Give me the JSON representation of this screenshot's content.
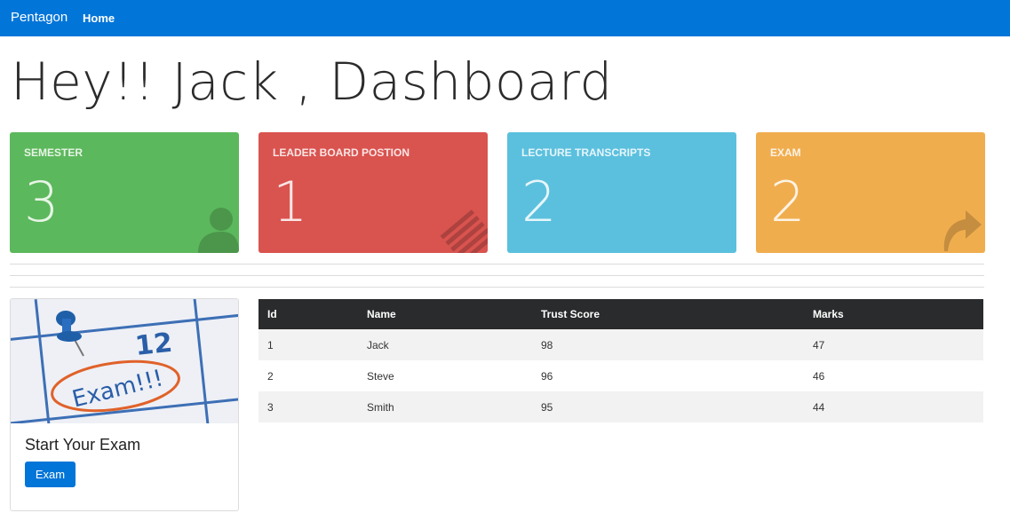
{
  "navbar": {
    "brand": "Pentagon",
    "home_label": "Home"
  },
  "page": {
    "title": "Hey!! Jack , Dashboard"
  },
  "stats": [
    {
      "label": "SEMESTER",
      "value": "3",
      "color": "#5cb85c",
      "icon": "user-icon"
    },
    {
      "label": "LEADER BOARD POSTION",
      "value": "1",
      "color": "#d9534f",
      "icon": "list-icon"
    },
    {
      "label": "LECTURE TRANSCRIPTS",
      "value": "2",
      "color": "#5bc0de",
      "icon": "document-icon"
    },
    {
      "label": "EXAM",
      "value": "2",
      "color": "#f0ad4e",
      "icon": "share-arrow-icon"
    }
  ],
  "exam_card": {
    "image_text": "Exam!!!",
    "image_number": "12",
    "title": "Start Your Exam",
    "button_label": "Exam"
  },
  "leaderboard": {
    "headers": [
      "Id",
      "Name",
      "Trust Score",
      "Marks"
    ],
    "rows": [
      [
        "1",
        "Jack",
        "98",
        "47"
      ],
      [
        "2",
        "Steve",
        "96",
        "46"
      ],
      [
        "3",
        "Smith",
        "95",
        "44"
      ]
    ]
  },
  "colors": {
    "primary": "#0275d8",
    "table_header": "#292b2c"
  }
}
